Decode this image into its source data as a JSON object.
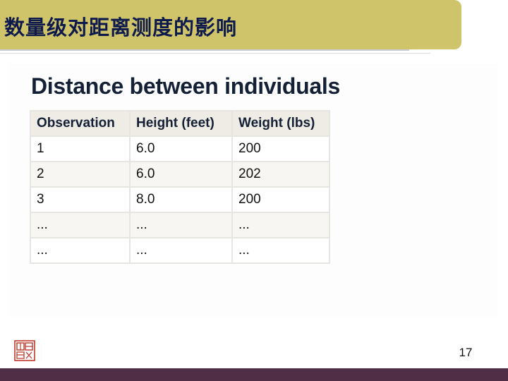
{
  "slide": {
    "title": "数量级对距离测度的影响",
    "page_number": "17"
  },
  "content": {
    "heading": "Distance between individuals",
    "table": {
      "headers": [
        "Observation",
        "Height (feet)",
        "Weight (lbs)"
      ],
      "rows": [
        [
          "1",
          "6.0",
          "200"
        ],
        [
          "2",
          "6.0",
          "202"
        ],
        [
          "3",
          "8.0",
          "200"
        ],
        [
          "...",
          "...",
          "..."
        ],
        [
          "...",
          "...",
          "..."
        ]
      ]
    }
  },
  "colors": {
    "title_bar": "#cfc46a",
    "title_text": "#0e1a4c",
    "footer_bar": "#4f2e46",
    "logo_red": "#c0392b"
  },
  "icons": {
    "logo": "university-seal-icon"
  }
}
